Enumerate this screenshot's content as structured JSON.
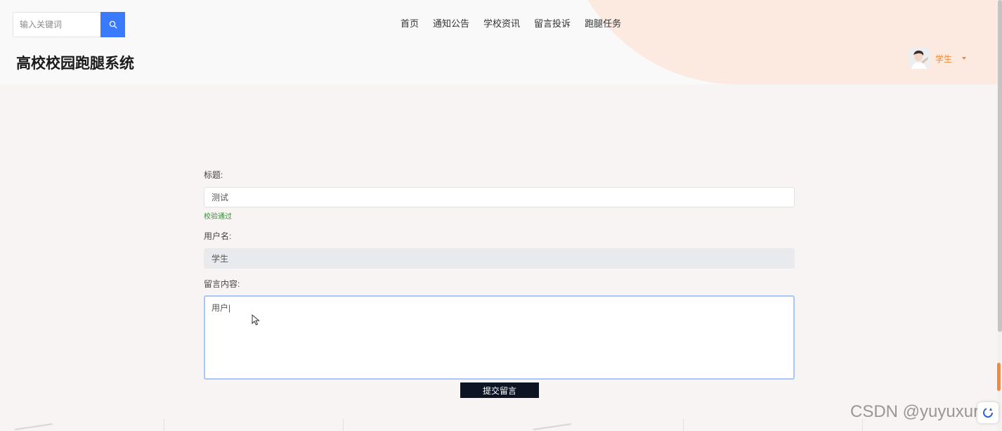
{
  "search": {
    "placeholder": "输入关键词",
    "icon": "search-icon"
  },
  "nav": {
    "items": [
      "首页",
      "通知公告",
      "学校资讯",
      "留言投诉",
      "跑腿任务"
    ]
  },
  "site_title": "高校校园跑腿系统",
  "user": {
    "name": "学生",
    "icon": "chevron-down-icon"
  },
  "form": {
    "title_label": "标题:",
    "title_value": "测试",
    "title_validation": "校验通过",
    "username_label": "用户名:",
    "username_value": "学生",
    "content_label": "留言内容:",
    "content_value": "用户|"
  },
  "submit_label": "提交留言",
  "watermark": "CSDN @yuyuxuro",
  "colors": {
    "accent_blue": "#3a7afe",
    "user_orange": "#f08a3c",
    "valid_green": "#3a8a3a",
    "submit_dark": "#0d1424",
    "header_blob": "#fce9df"
  }
}
